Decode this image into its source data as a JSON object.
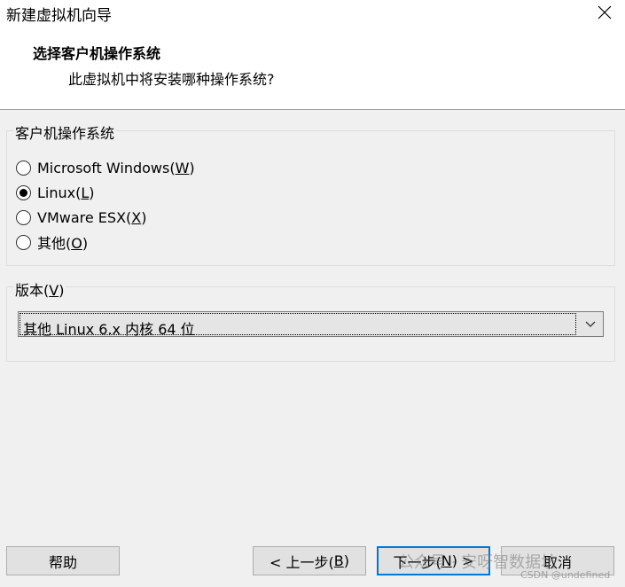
{
  "window": {
    "title": "新建虚拟机向导",
    "close_icon": "close-icon"
  },
  "header": {
    "title": "选择客户机操作系统",
    "subtitle": "此虚拟机中将安装哪种操作系统?"
  },
  "os_group": {
    "legend": "客户机操作系统",
    "options": [
      {
        "label": "Microsoft Windows(",
        "mnemonic": "W",
        "suffix": ")",
        "checked": false
      },
      {
        "label": "Linux(",
        "mnemonic": "L",
        "suffix": ")",
        "checked": true
      },
      {
        "label": "VMware ESX(",
        "mnemonic": "X",
        "suffix": ")",
        "checked": false
      },
      {
        "label": "其他(",
        "mnemonic": "O",
        "suffix": ")",
        "checked": false
      }
    ]
  },
  "version_group": {
    "legend_prefix": "版本(",
    "legend_mnemonic": "V",
    "legend_suffix": ")",
    "selected": "其他 Linux 6.x 内核 64 位"
  },
  "buttons": {
    "help": "帮助",
    "back_prefix": "< 上一步(",
    "back_mnemonic": "B",
    "back_suffix": ")",
    "next_prefix": "下一步(",
    "next_mnemonic": "N",
    "next_suffix": ") >",
    "cancel": "取消"
  },
  "watermark": {
    "text": "公众号 · 安呀智数据坊",
    "sub": "CSDN @undefined"
  }
}
